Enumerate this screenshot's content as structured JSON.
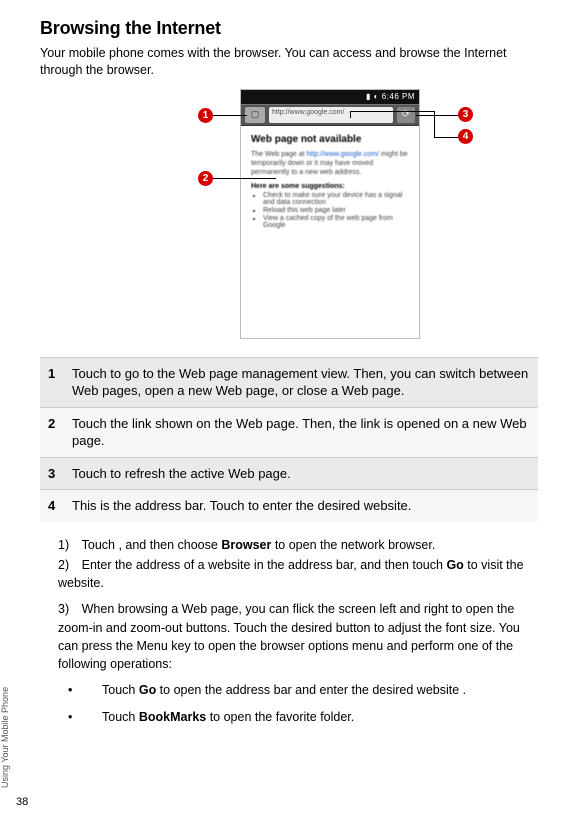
{
  "title": "Browsing the Internet",
  "intro": "Your mobile phone comes with the browser. You can access and browse the Internet through the browser.",
  "phone": {
    "time": "6:46 PM",
    "addr": "http://www.google.com/",
    "pageTitle": "Web page not available",
    "para_a": "The Web page at ",
    "para_link": "http://www.google.com/",
    "para_b": " might be temporarily down or it may have moved permanently to a new web address.",
    "sugg": "Here are some suggestions:",
    "li1": "Check to make sure your device has a signal and data connection",
    "li2": "Reload this web page later",
    "li3": "View a cached copy of the web page from Google"
  },
  "callouts": {
    "c1": "1",
    "c2": "2",
    "c3": "3",
    "c4": "4"
  },
  "legend": [
    {
      "n": "1",
      "t": "Touch to go to the Web page management view. Then, you can switch between Web pages, open a new Web page, or close a Web page."
    },
    {
      "n": "2",
      "t": "Touch the link shown on the Web page. Then, the link is opened on a new Web page."
    },
    {
      "n": "3",
      "t": "Touch to refresh the active Web page."
    },
    {
      "n": "4",
      "t": "This is the address bar. Touch to enter the desired website."
    }
  ],
  "steps": {
    "s1a": "1) Touch , and then choose ",
    "s1_bold": "Browser",
    "s1b": " to open the network browser.",
    "s2a": "2) Enter the address of a website in the address bar, and then touch ",
    "s2_bold": "Go",
    "s2b": " to visit the website.",
    "s3": "3) When browsing a Web page, you can flick the screen left and right to open the zoom-in and zoom-out buttons. Touch the desired button to adjust the font size. You can press the Menu key to open the browser options menu and perform one of the following operations:"
  },
  "bullets": {
    "b1a": "Touch ",
    "b1_bold": "Go",
    "b1b": " to open the address bar and enter the desired website .",
    "b2a": "Touch ",
    "b2_bold": "BookMarks",
    "b2b": " to open the favorite folder."
  },
  "side": "Using Your Mobile Phone",
  "page": "38"
}
